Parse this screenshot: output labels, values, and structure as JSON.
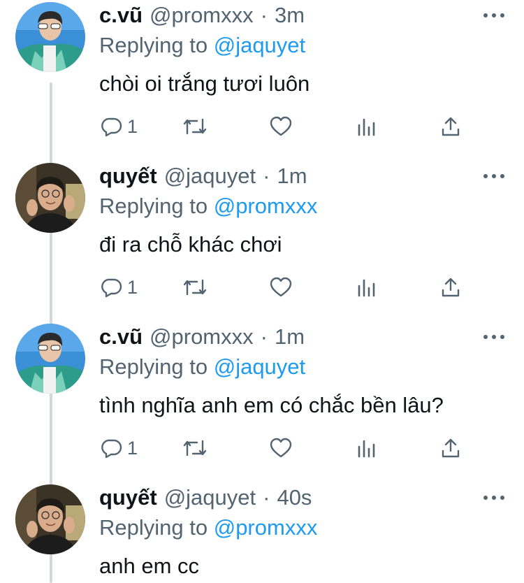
{
  "tweets": [
    {
      "name": "c.vũ",
      "handle": "@promxxx",
      "time": "3m",
      "replying_prefix": "Replying to",
      "replying_to": "@jaquyet",
      "text": "chòi oi trắng tươi luôn",
      "reply_count": "1",
      "avatar": "avatar-cvu"
    },
    {
      "name": "quyết",
      "handle": "@jaquyet",
      "time": "1m",
      "replying_prefix": "Replying to",
      "replying_to": "@promxxx",
      "text": "đi ra chỗ khác chơi",
      "reply_count": "1",
      "avatar": "avatar-quyet"
    },
    {
      "name": "c.vũ",
      "handle": "@promxxx",
      "time": "1m",
      "replying_prefix": "Replying to",
      "replying_to": "@jaquyet",
      "text": "tình nghĩa anh em có chắc bền lâu?",
      "reply_count": "1",
      "avatar": "avatar-cvu"
    },
    {
      "name": "quyết",
      "handle": "@jaquyet",
      "time": "40s",
      "replying_prefix": "Replying to",
      "replying_to": "@promxxx",
      "text": "anh em cc",
      "avatar": "avatar-quyet"
    }
  ],
  "separator": "·",
  "icons": [
    "reply-icon",
    "retweet-icon",
    "like-icon",
    "analytics-icon",
    "share-icon",
    "more-icon"
  ],
  "colors": {
    "text": "#0f1419",
    "muted": "#536471",
    "link": "#1d9bf0",
    "thread": "#cfd9de"
  }
}
